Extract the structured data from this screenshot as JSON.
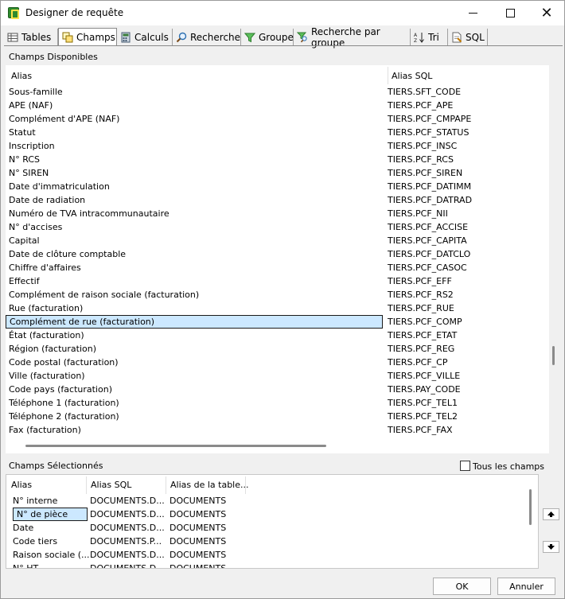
{
  "window": {
    "title": "Designer de requête"
  },
  "tabs": [
    {
      "label": "Tables",
      "icon": "table-icon"
    },
    {
      "label": "Champs",
      "icon": "fields-icon",
      "active": true
    },
    {
      "label": "Calculs",
      "icon": "calculator-icon"
    },
    {
      "label": "Recherche",
      "icon": "magnifier-icon"
    },
    {
      "label": "Groupe",
      "icon": "funnel-icon"
    },
    {
      "label": "Recherche par groupe",
      "icon": "group-search-icon"
    },
    {
      "label": "Tri",
      "icon": "sort-az-icon"
    },
    {
      "label": "SQL",
      "icon": "sql-icon"
    }
  ],
  "available": {
    "label": "Champs Disponibles",
    "headers": {
      "alias": "Alias",
      "sql_alias": "Alias SQL"
    },
    "rows": [
      [
        "Sous-famille",
        "TIERS.SFT_CODE"
      ],
      [
        "APE (NAF)",
        "TIERS.PCF_APE"
      ],
      [
        "Complément d'APE (NAF)",
        "TIERS.PCF_CMPAPE"
      ],
      [
        "Statut",
        "TIERS.PCF_STATUS"
      ],
      [
        "Inscription",
        "TIERS.PCF_INSC"
      ],
      [
        "N° RCS",
        "TIERS.PCF_RCS"
      ],
      [
        "N° SIREN",
        "TIERS.PCF_SIREN"
      ],
      [
        "Date d'immatriculation",
        "TIERS.PCF_DATIMM"
      ],
      [
        "Date de radiation",
        "TIERS.PCF_DATRAD"
      ],
      [
        "Numéro de TVA intracommunautaire",
        "TIERS.PCF_NII"
      ],
      [
        "N° d'accises",
        "TIERS.PCF_ACCISE"
      ],
      [
        "Capital",
        "TIERS.PCF_CAPITA"
      ],
      [
        "Date de clôture comptable",
        "TIERS.PCF_DATCLO"
      ],
      [
        "Chiffre d'affaires",
        "TIERS.PCF_CASOC"
      ],
      [
        "Effectif",
        "TIERS.PCF_EFF"
      ],
      [
        "Complément de raison sociale (facturation)",
        "TIERS.PCF_RS2"
      ],
      [
        "Rue (facturation)",
        "TIERS.PCF_RUE"
      ],
      [
        "Complément de rue (facturation)",
        "TIERS.PCF_COMP"
      ],
      [
        "État (facturation)",
        "TIERS.PCF_ETAT"
      ],
      [
        "Région (facturation)",
        "TIERS.PCF_REG"
      ],
      [
        "Code postal (facturation)",
        "TIERS.PCF_CP"
      ],
      [
        "Ville (facturation)",
        "TIERS.PCF_VILLE"
      ],
      [
        "Code pays (facturation)",
        "TIERS.PAY_CODE"
      ],
      [
        "Téléphone 1 (facturation)",
        "TIERS.PCF_TEL1"
      ],
      [
        "Téléphone 2 (facturation)",
        "TIERS.PCF_TEL2"
      ],
      [
        "Fax (facturation)",
        "TIERS.PCF_FAX"
      ]
    ],
    "selected_index": 17
  },
  "selected": {
    "label": "Champs Sélectionnés",
    "all_fields_label": "Tous les champs",
    "headers": {
      "alias": "Alias",
      "sql_alias": "Alias SQL",
      "table_alias": "Alias de la table..."
    },
    "rows": [
      [
        "N° interne",
        "DOCUMENTS.D...",
        "DOCUMENTS"
      ],
      [
        "N° de pièce",
        "DOCUMENTS.D...",
        "DOCUMENTS"
      ],
      [
        "Date",
        "DOCUMENTS.D...",
        "DOCUMENTS"
      ],
      [
        "Code tiers",
        "DOCUMENTS.P...",
        "DOCUMENTS"
      ],
      [
        "Raison sociale (...",
        "DOCUMENTS.D...",
        "DOCUMENTS"
      ],
      [
        "N° HT...",
        "DOCUMENTS.D...",
        "DOCUMENTS"
      ]
    ],
    "selected_index": 1
  },
  "buttons": {
    "ok": "OK",
    "cancel": "Annuler"
  }
}
